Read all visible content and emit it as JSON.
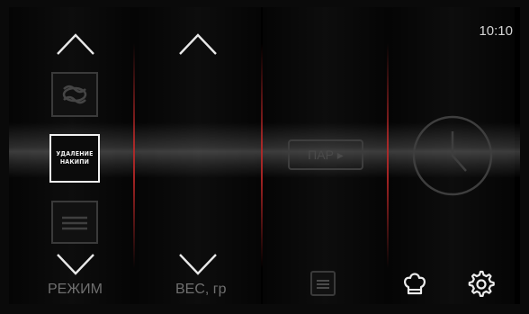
{
  "status": {
    "time": "10:10"
  },
  "mode_column": {
    "selected_mode_label": "УДАЛЕНИЕ\nНАКИПИ",
    "label": "РЕЖИМ",
    "above_icon": "hot-air-fan-icon",
    "below_icon": "grill-heat-icon"
  },
  "weight_column": {
    "label": "ВЕС, гр"
  },
  "steam_column": {
    "steam_button_label": "ПАР ▸",
    "bottom_icon": "menu-list-icon"
  },
  "timer_column": {
    "icon": "clock-icon"
  },
  "bottom_right": {
    "chef_icon": "chef-hat-icon",
    "settings_icon": "gear-icon"
  },
  "colors": {
    "divider": "#be2828",
    "accent_text": "#f2f2f2",
    "dim_text": "#6f6f6f"
  }
}
